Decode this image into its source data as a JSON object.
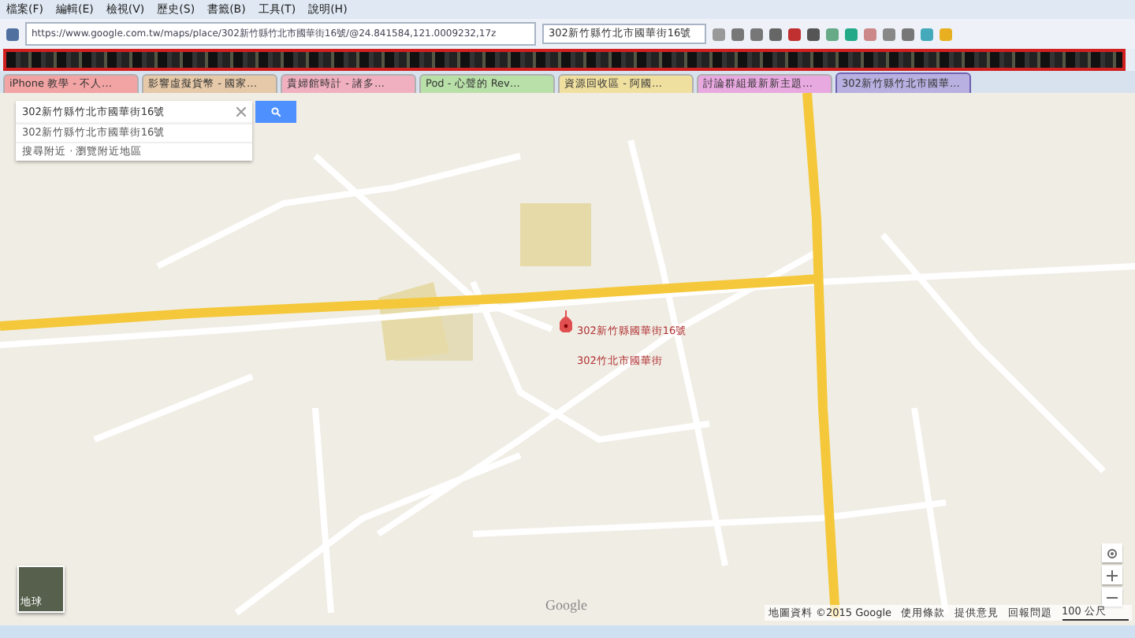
{
  "menu": [
    "檔案(F)",
    "編輯(E)",
    "檢視(V)",
    "歷史(S)",
    "書籤(B)",
    "工具(T)",
    "說明(H)"
  ],
  "url": "https://www.google.com.tw/maps/place/302新竹縣竹北市國華街16號/@24.841584,121.0009232,17z",
  "toolbar_search": "302新竹縣竹北市國華街16號",
  "tabs": [
    {
      "label": "iPhone 教學 - 不人…",
      "color": "#f2a3a3",
      "selected": false
    },
    {
      "label": "影響虛擬貨幣 - 國家…",
      "color": "#e6c9a8",
      "selected": false
    },
    {
      "label": "貴婦館時計 - 諸多…",
      "color": "#f0b0c0",
      "selected": false
    },
    {
      "label": "Pod - 心聲的 Rev…",
      "color": "#b8e0a8",
      "selected": false
    },
    {
      "label": "資源回收區 - 阿國…",
      "color": "#f0e0a0",
      "selected": false
    },
    {
      "label": "討論群組最新新主題…",
      "color": "#e8a8e0",
      "selected": false
    },
    {
      "label": "302新竹縣竹北市國華…",
      "color": "#b8b0e0",
      "selected": true
    }
  ],
  "search": {
    "value": "302新竹縣竹北市國華街16號",
    "suggestions": [
      "302新竹縣竹北市國華街16號",
      "搜尋附近 · 瀏覽附近地區"
    ]
  },
  "marker": {
    "lines": [
      "302新竹縣國華街16號",
      "302竹北市國華街"
    ]
  },
  "satellite_label": "地球",
  "logo": "Google",
  "footer": [
    "地圖資料 ©2015 Google",
    "使用條款",
    "提供意見",
    "回報問題"
  ],
  "scale": "100 公尺"
}
